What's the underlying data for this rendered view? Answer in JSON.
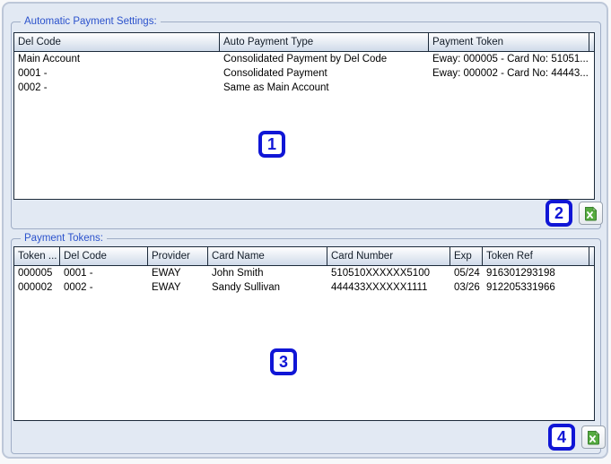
{
  "colors": {
    "annotation_blue": "#1016d6",
    "groupbox_title_blue": "#2b52cc",
    "panel_background": "#e2e9f3",
    "table_border_navy": "#1c2a3a",
    "excel_icon_green": "#4ea33c"
  },
  "sections": [
    {
      "title": "Automatic Payment Settings:",
      "table": {
        "columns": [
          "Del Code",
          "Auto Payment Type",
          "Payment Token"
        ],
        "rows": [
          [
            "Main Account",
            "Consolidated Payment by Del Code",
            "Eway: 000005 - Card No: 51051..."
          ],
          [
            "0001 -",
            "Consolidated Payment",
            "Eway: 000002 - Card No: 44443..."
          ],
          [
            "0002 -",
            "Same as Main Account",
            ""
          ]
        ]
      },
      "annotation_area": "1",
      "annotation_export": "2",
      "export_icon": "excel-export-icon"
    },
    {
      "title": "Payment Tokens:",
      "table": {
        "columns": [
          "Token ...",
          "Del Code",
          "Provider",
          "Card Name",
          "Card Number",
          "Exp",
          "Token Ref"
        ],
        "rows": [
          [
            "000005",
            "0001 -",
            "EWAY",
            "John Smith",
            "510510XXXXXX5100",
            "05/24",
            "916301293198"
          ],
          [
            "000002",
            "0002 -",
            "EWAY",
            "Sandy Sullivan",
            "444433XXXXXX1111",
            "03/26",
            "912205331966"
          ]
        ]
      },
      "annotation_area": "3",
      "annotation_export": "4",
      "export_icon": "excel-export-icon"
    }
  ]
}
